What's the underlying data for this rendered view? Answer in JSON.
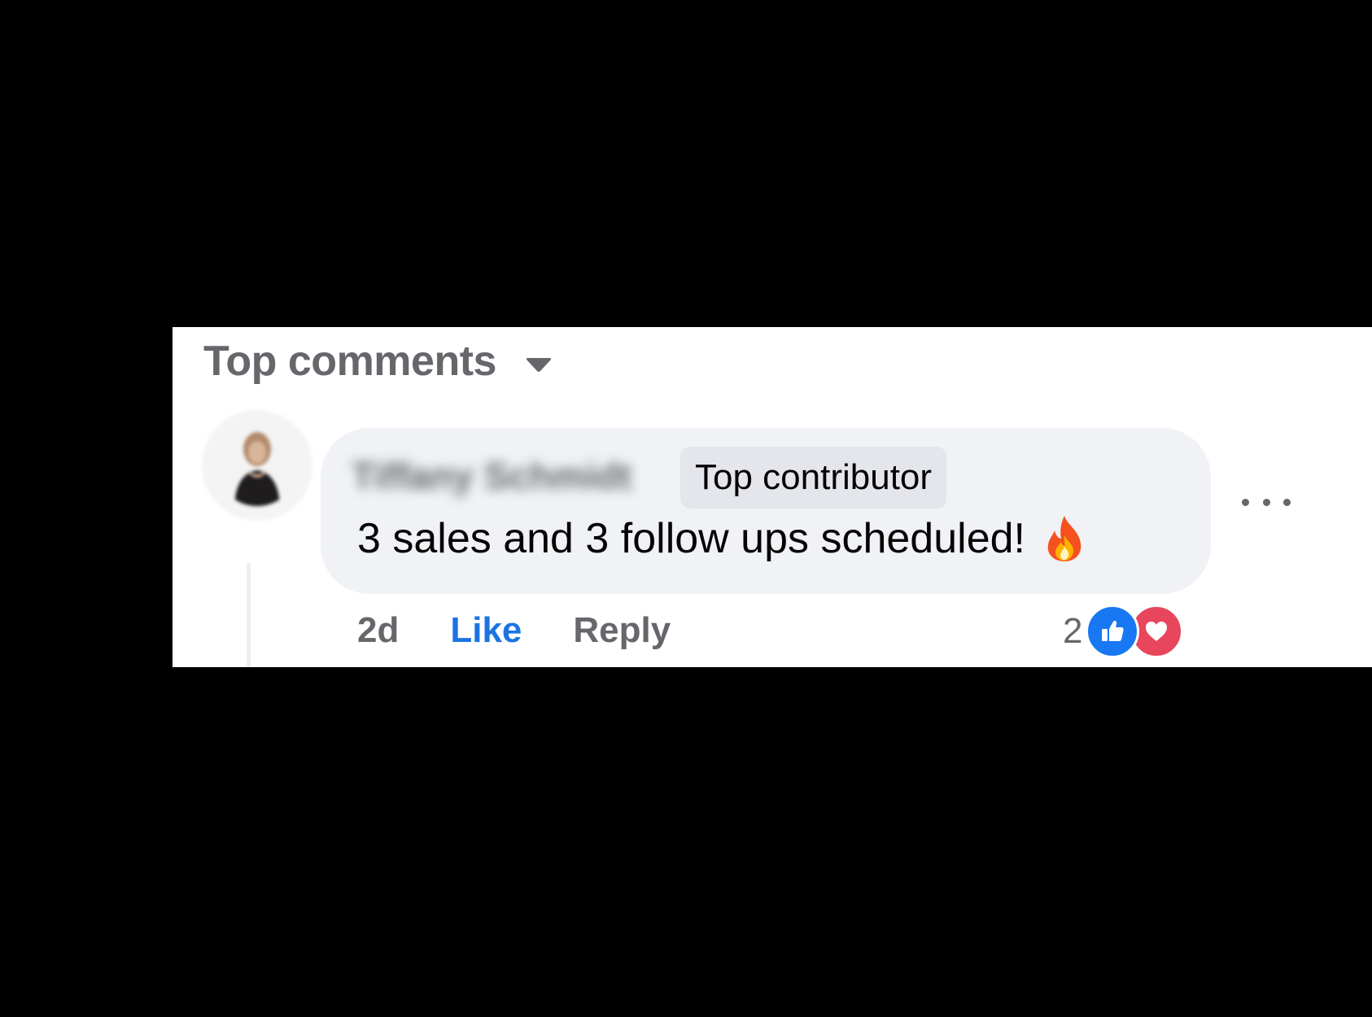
{
  "comments_section": {
    "sort_label": "Top comments",
    "sort_icon": "caret-down-icon"
  },
  "comment": {
    "author": "Tiffany Schmidt",
    "badge": "Top contributor",
    "text": "3 sales and 3 follow ups scheduled!",
    "emoji_icon": "fire-emoji-icon",
    "time": "2d",
    "like_label": "Like",
    "reply_label": "Reply",
    "reaction_count": "2",
    "reaction_icons": [
      "like-reaction-icon",
      "love-reaction-icon"
    ]
  },
  "colors": {
    "like_blue": "#1b74e4",
    "love_red": "#e8465c",
    "bubble_bg": "#f0f2f5",
    "secondary_text": "#65676b"
  }
}
